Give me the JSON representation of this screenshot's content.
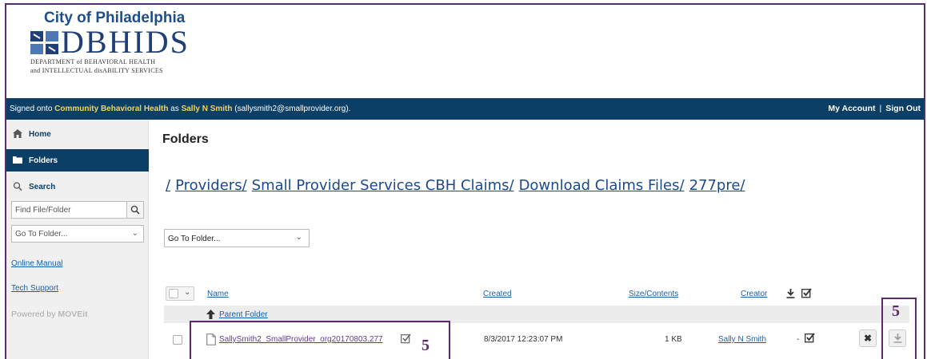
{
  "header": {
    "city": "City of Philadelphia",
    "brand": "DBHIDS",
    "dept_line1": "DEPARTMENT of BEHAVIORAL HEALTH",
    "dept_line2": "and INTELLECTUAL disABILITY SERVICES"
  },
  "statusbar": {
    "signed_prefix": "Signed onto",
    "org": "Community Behavioral Health",
    "as_text": "as",
    "user": "Sally N Smith",
    "email": "(sallysmith2@smallprovider.org).",
    "my_account": "My Account",
    "separator": "|",
    "sign_out": "Sign Out"
  },
  "sidebar": {
    "home": "Home",
    "folders": "Folders",
    "search": "Search",
    "find_placeholder": "Find File/Folder",
    "goto": "Go To Folder...",
    "online_manual": "Online Manual",
    "tech_support": "Tech Support",
    "powered_by": "Powered by",
    "powered_brand": "MOVEit"
  },
  "main": {
    "title": "Folders",
    "crumb_root": "/",
    "crumbs": [
      "Providers/",
      "Small Provider Services CBH Claims/",
      "Download Claims Files/",
      "277pre/"
    ],
    "goto": "Go To Folder...",
    "columns": {
      "name": "Name",
      "created": "Created",
      "size": "Size/Contents",
      "creator": "Creator"
    },
    "parent_folder": "Parent Folder",
    "file": {
      "name": "SallySmith2_SmallProvider_org20170803.277",
      "created": "8/3/2017 12:23:07 PM",
      "size": "1 KB",
      "creator": "Sally N Smith",
      "downloads": "-"
    }
  },
  "callouts": [
    "5",
    "5"
  ],
  "colors": {
    "navy": "#0c3f66",
    "highlight": "#f2d35b",
    "callout": "#5b2a6e",
    "link": "#1b5fa8"
  }
}
